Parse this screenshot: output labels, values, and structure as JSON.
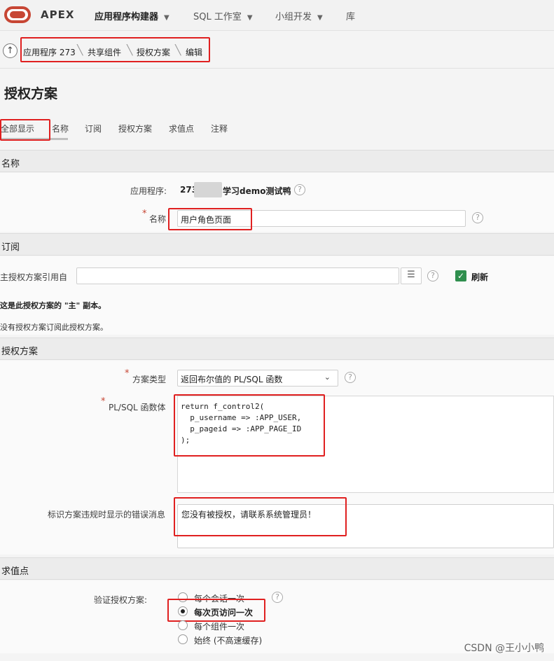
{
  "header": {
    "app_name": "APEX",
    "nav": [
      "应用程序构建器",
      "SQL 工作室",
      "小组开发",
      "库"
    ],
    "logo_color": "#c74634"
  },
  "breadcrumb": {
    "items": [
      "应用程序 273",
      "共享组件",
      "授权方案",
      "编辑"
    ]
  },
  "page_title": "授权方案",
  "tabs": [
    "全部显示",
    "名称",
    "订阅",
    "授权方案",
    "求值点",
    "注释"
  ],
  "sections": {
    "name": {
      "title": "名称",
      "app_label": "应用程序:",
      "app_value_prefix": "273",
      "app_value_suffix": "学习demo测试鸭",
      "name_label": "名称",
      "name_value": "用户角色页面"
    },
    "subscription": {
      "title": "订阅",
      "ref_label": "主授权方案引用自",
      "ref_value": "",
      "refresh_label": "刷新",
      "master_note": "这是此授权方案的 \"主\" 副本。",
      "none_note": "没有授权方案订阅此授权方案。"
    },
    "scheme": {
      "title": "授权方案",
      "type_label": "方案类型",
      "type_value": "返回布尔值的 PL/SQL 函数",
      "body_label": "PL/SQL 函数体",
      "body_lines": [
        "return f_control2(",
        "  p_username => :APP_USER,",
        "  p_pageid => :APP_PAGE_ID",
        ");"
      ],
      "error_label": "标识方案违规时显示的错误消息",
      "error_value": "您没有被授权，请联系系统管理员！"
    },
    "evaluation": {
      "title": "求值点",
      "verify_label": "验证授权方案:",
      "options": [
        "每个会话一次",
        "每次页访问一次",
        "每个组件一次",
        "始终 (不高速缓存)"
      ],
      "selected": "每次页访问一次"
    }
  },
  "watermark": "CSDN @王小小鸭"
}
